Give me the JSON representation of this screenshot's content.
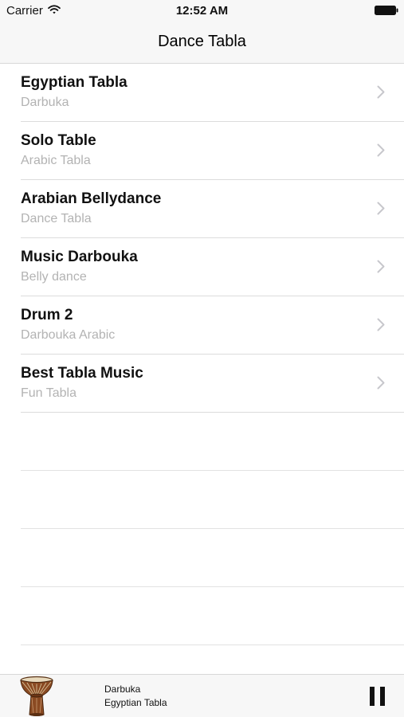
{
  "status_bar": {
    "carrier": "Carrier",
    "time": "12:52 AM",
    "icons": [
      "wifi-icon",
      "battery-icon"
    ]
  },
  "nav": {
    "title": "Dance Tabla"
  },
  "list": {
    "items": [
      {
        "title": "Egyptian Tabla",
        "subtitle": "Darbuka"
      },
      {
        "title": "Solo Table",
        "subtitle": "Arabic Tabla"
      },
      {
        "title": "Arabian Bellydance",
        "subtitle": "Dance Tabla"
      },
      {
        "title": "Music Darbouka",
        "subtitle": "Belly dance"
      },
      {
        "title": "Drum 2",
        "subtitle": "Darbouka Arabic"
      },
      {
        "title": "Best Tabla Music",
        "subtitle": "Fun Tabla"
      }
    ],
    "row_icon": "chevron-right-icon"
  },
  "player": {
    "track_title": "Darbuka",
    "track_subtitle": "Egyptian Tabla",
    "artwork_icon": "djembe-drum-icon",
    "control_icon": "pause-icon"
  },
  "colors": {
    "bar_background": "#f7f7f7",
    "separator": "#dcdcdc",
    "subtitle_text": "#b3b3b3",
    "chevron": "#c7c7cc"
  }
}
